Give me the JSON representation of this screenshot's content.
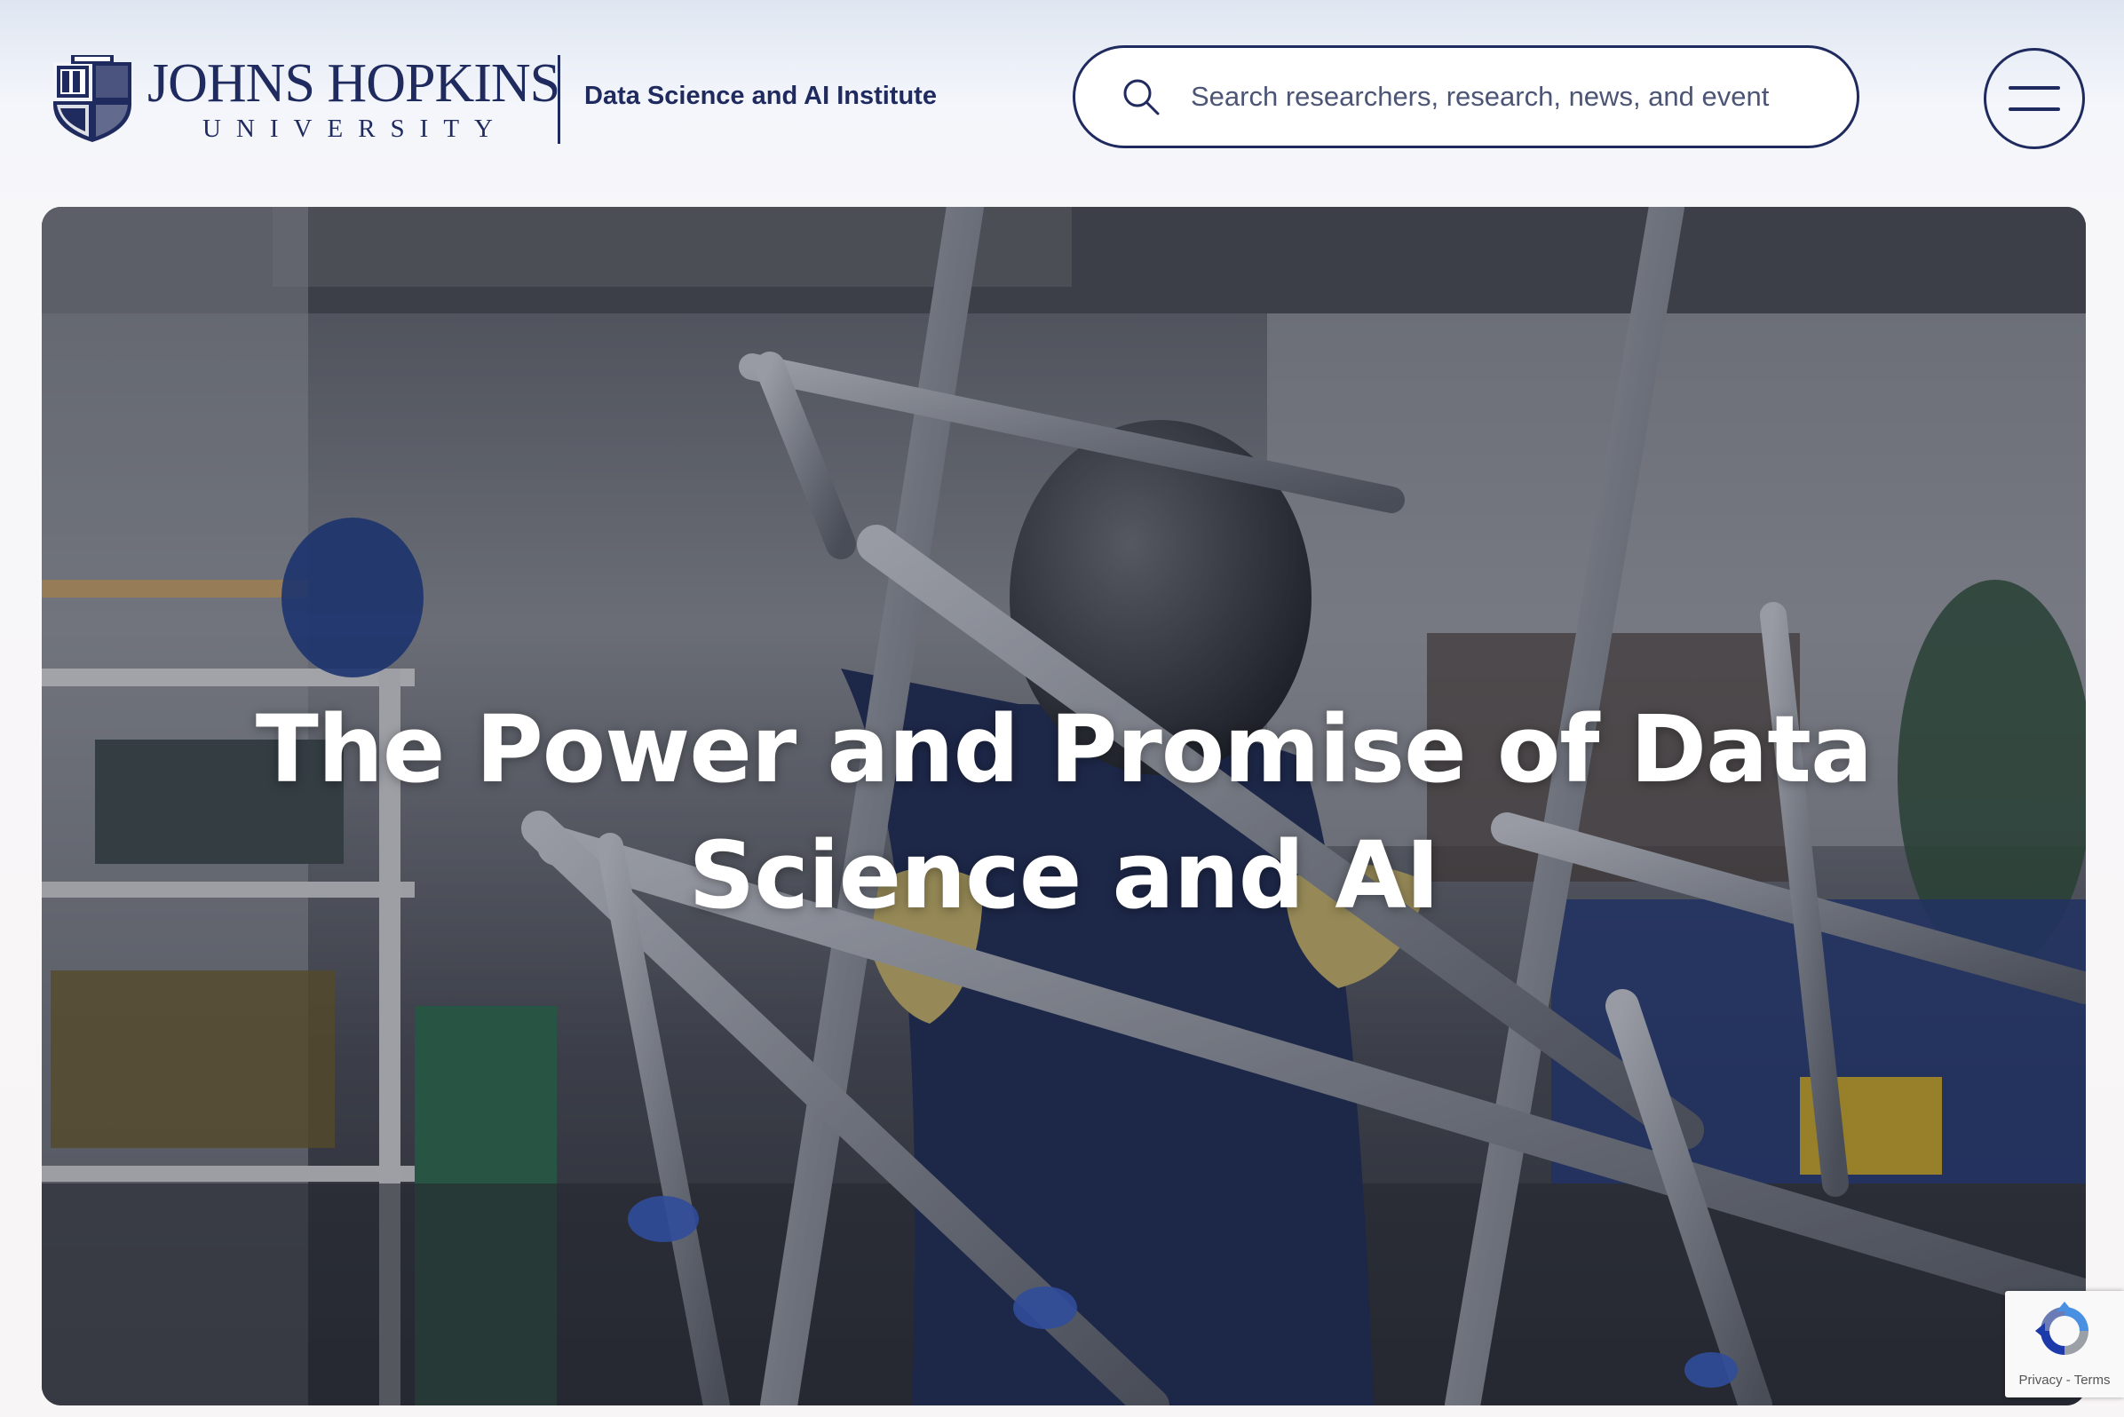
{
  "header": {
    "logo": {
      "name_line": "JOHNS HOPKINS",
      "sub_line": "UNIVERSITY"
    },
    "institute_name": "Data Science and AI Institute",
    "search": {
      "placeholder": "Search researchers, research, news, and event"
    },
    "menu_icon": "hamburger-menu-icon"
  },
  "hero": {
    "title": "The Power and Promise of Data Science and AI",
    "image_description_icon": "welding-workshop-photo"
  },
  "recaptcha": {
    "privacy_label": "Privacy",
    "separator": "-",
    "terms_label": "Terms"
  },
  "colors": {
    "brand_navy": "#1f2a5e",
    "hero_text": "#ffffff"
  }
}
